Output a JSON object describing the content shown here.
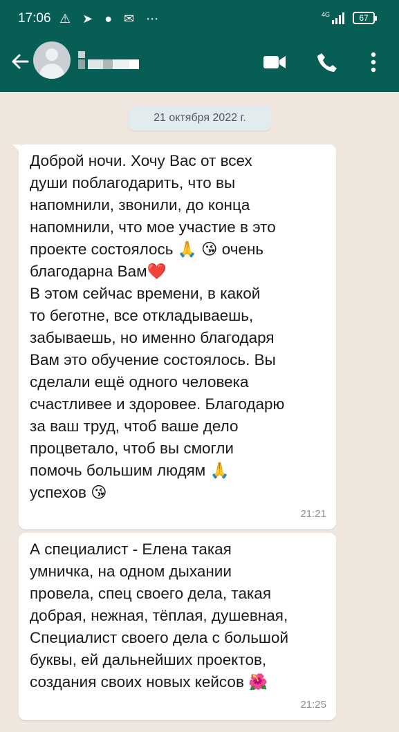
{
  "status_bar": {
    "time": "17:06",
    "network": "4G",
    "battery": "67"
  },
  "header": {
    "back_icon": "arrow-left-icon",
    "avatar_icon": "default-avatar-icon",
    "contact_name": "",
    "video_call_icon": "video-camera-icon",
    "voice_call_icon": "phone-icon",
    "menu_icon": "more-vertical-icon"
  },
  "chat": {
    "date_label": "21 октября 2022 г.",
    "messages": [
      {
        "text": "Доброй ночи. Хочу Вас от всех\nдуши поблагодарить, что вы\nнапомнили, звонили, до конца\nнапомнили, что мое участие в это\nпроекте состоялось 🙏 😘 очень\nблагодарна Вам❤️\nВ этом сейчас времени, в какой\nто беготне, все откладываешь,\nзабываешь, но именно благодаря\nВам это обучение состоялось. Вы\nсделали ещё одного человека\nсчастливее и здоровее. Благодарю\nза ваш труд, чтоб ваше дело\nпроцветало, чтоб вы смогли\nпомочь большим людям 🙏\nуспехов 😘",
        "time": "21:21"
      },
      {
        "text": "А специалист - Елена такая\nумничка, на одном дыхании\nпровела, спец своего дела, такая\nдобрая, нежная, тёплая, душевная,\nСпециалист своего дела с большой\nбуквы, ей дальнейших проектов,\nсоздания своих новых кейсов 🌺",
        "time": "21:25"
      }
    ]
  },
  "colors": {
    "header_bg": "#075e54",
    "chat_bg": "#efe7de",
    "bubble_bg": "#ffffff",
    "date_chip_bg": "#e2ecef"
  }
}
